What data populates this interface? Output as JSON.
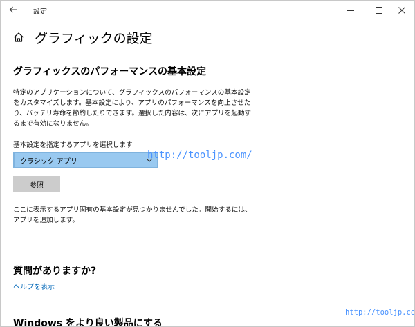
{
  "window": {
    "title": "設定"
  },
  "header": {
    "page_title": "グラフィックの設定"
  },
  "performance": {
    "section_title": "グラフィックスのパフォーマンスの基本設定",
    "description": "特定のアプリケーションについて、グラフィックスのパフォーマンスの基本設定をカスタマイズします。基本設定により、アプリのパフォーマンスを向上させたり、バッテリ寿命を節約したりできます。選択した内容は、次にアプリを起動するまで有効になりません。",
    "select_label": "基本設定を指定するアプリを選択します",
    "selected_app": "クラシック アプリ",
    "browse_label": "参照",
    "notice": "ここに表示するアプリ固有の基本設定が見つかりませんでした。開始するには、アプリを追加します。"
  },
  "help": {
    "question_title": "質問がありますか?",
    "help_link": "ヘルプを表示"
  },
  "improve": {
    "title": "Windows をより良い製品にする"
  },
  "watermarks": {
    "center": "http://tooljp.com/",
    "corner": "http://tooljp.com/"
  },
  "icons": {
    "back": "back-arrow-icon",
    "minimize": "minimize-icon",
    "maximize": "maximize-icon",
    "close": "close-icon",
    "home": "home-icon",
    "dropdown": "chevron-down-icon"
  },
  "colors": {
    "select_bg": "#99c9f0",
    "button_bg": "#cccccc",
    "link": "#0067b8",
    "watermark": "#4a93ff"
  }
}
